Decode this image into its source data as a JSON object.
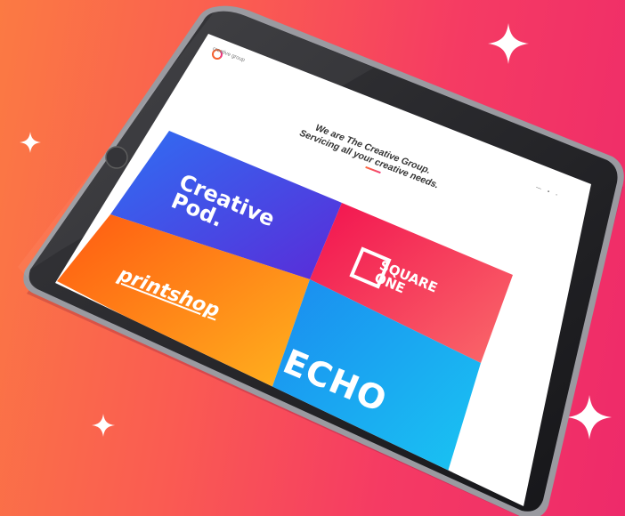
{
  "page": {
    "brand_name": "creative group",
    "tagline_line1": "We are The Creative Group.",
    "tagline_line2": "Servicing all your creative needs.",
    "nav": "— • ◦"
  },
  "tiles": {
    "pod_line1": "Creative",
    "pod_line2": "Pod.",
    "square_line1": "SQUARE",
    "square_line2": "ONE",
    "print": "printshop",
    "echo": "ECHO"
  },
  "colors": {
    "background_left": "#fb7a43",
    "background_right": "#ee2a6a",
    "pod": "#4a3fe0",
    "square": "#f3285a",
    "print": "#ff8a1e",
    "echo": "#1ea9f2"
  },
  "icons": {
    "sparkle": "four-point-star",
    "logo": "circle-mark"
  }
}
